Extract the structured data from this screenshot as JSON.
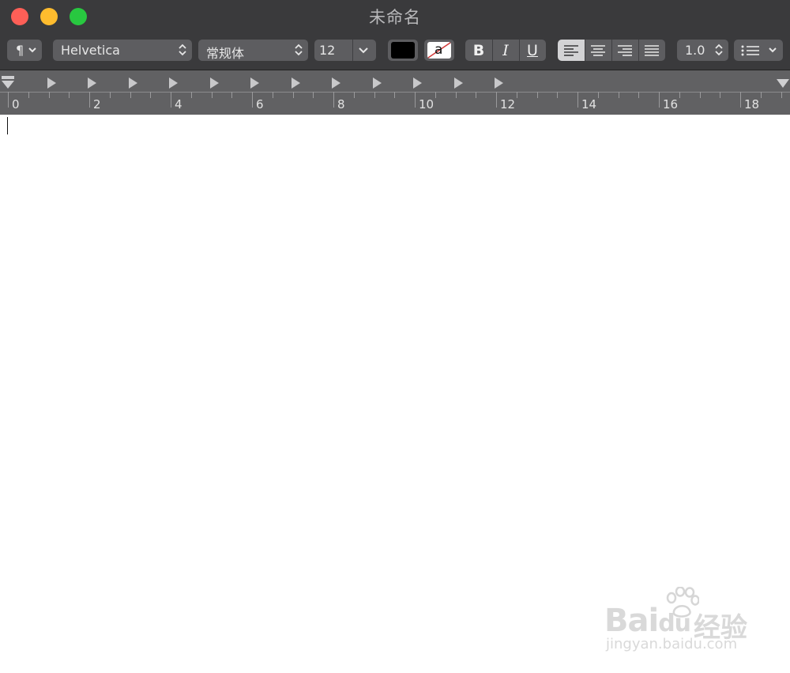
{
  "window": {
    "title": "未命名"
  },
  "toolbar": {
    "paragraph_glyph": "¶",
    "font_family": "Helvetica",
    "font_style": "常规体",
    "font_size": "12",
    "text_color": "#000000",
    "highlight_glyph": "a",
    "bold_label": "B",
    "italic_label": "I",
    "underline_label": "U",
    "line_spacing": "1.0"
  },
  "ruler": {
    "labels": [
      "0",
      "2",
      "4",
      "6",
      "8",
      "10",
      "12",
      "14",
      "16",
      "18"
    ]
  },
  "watermark": {
    "brand": "Bai",
    "brand2": "du",
    "cn": "经验",
    "url": "jingyan.baidu.com"
  }
}
